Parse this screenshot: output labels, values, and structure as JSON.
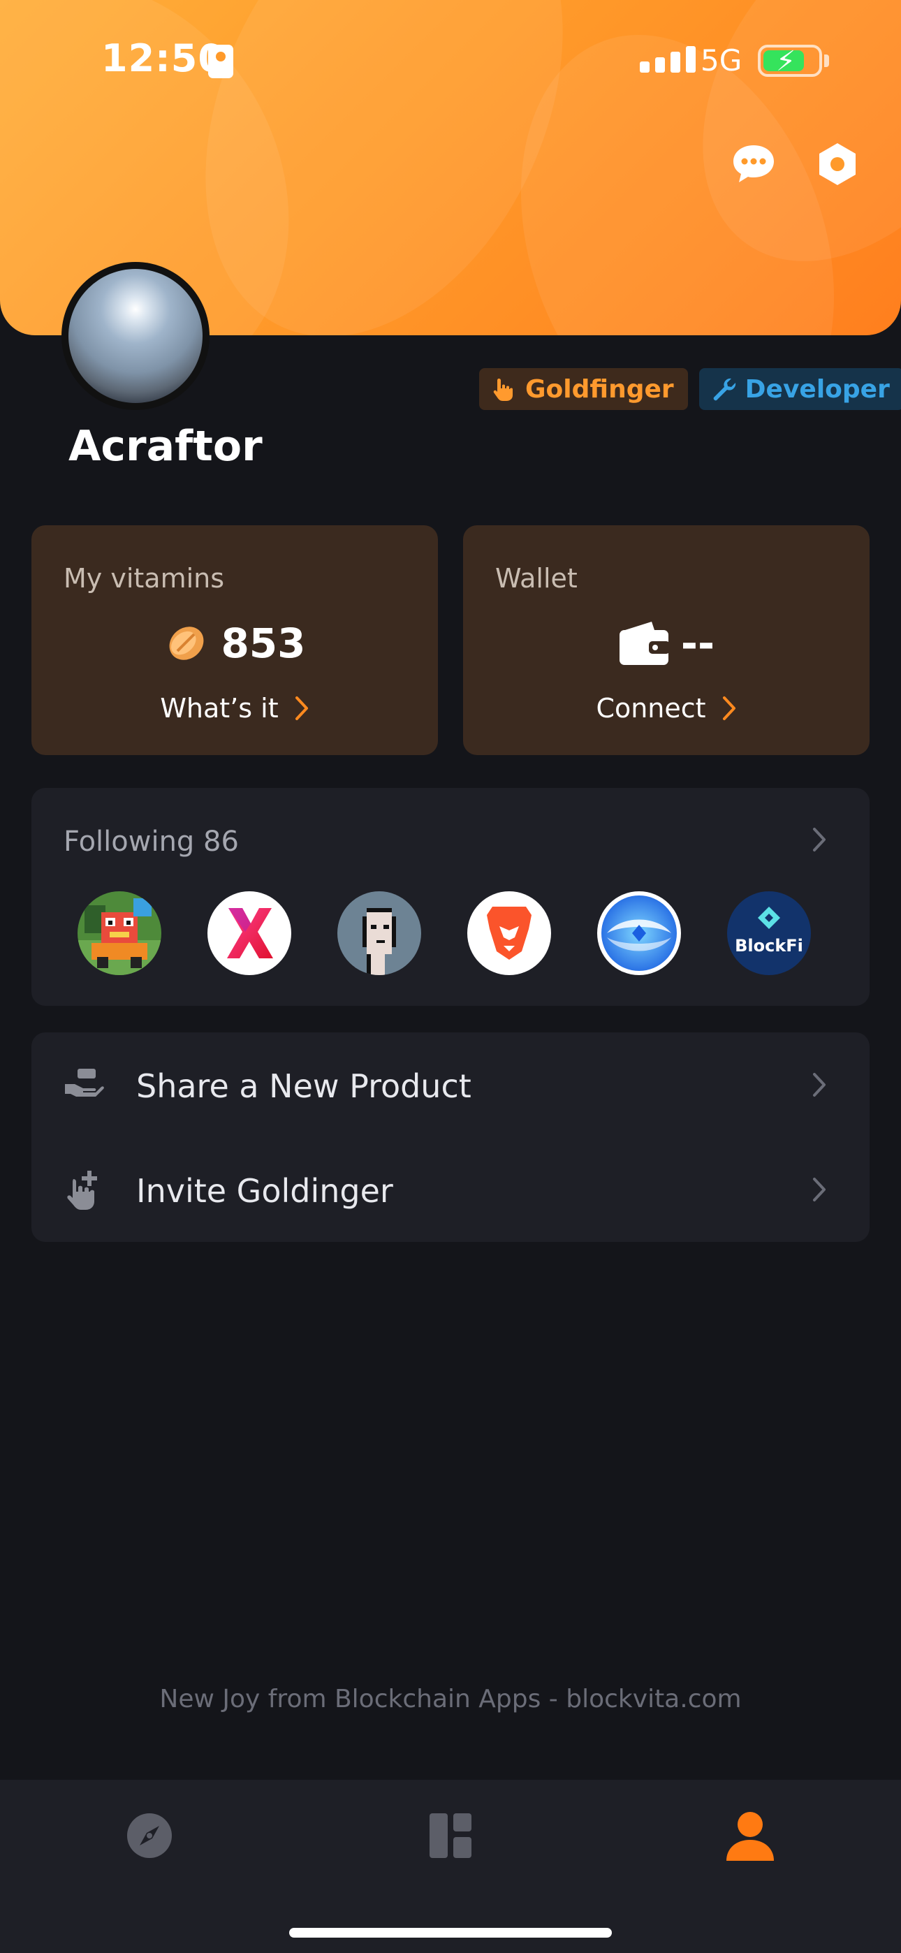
{
  "status_bar": {
    "time": "12:50",
    "network": "5G"
  },
  "header": {
    "message_icon": "chat-bubble-icon",
    "settings_icon": "hexagon-gear-icon"
  },
  "profile": {
    "username": "Acraftor",
    "badges": [
      {
        "label": "Goldfinger",
        "icon": "pointing-hand-icon",
        "color": "#ff9a2e"
      },
      {
        "label": "Developer",
        "icon": "wrench-icon",
        "color": "#38a3e5"
      }
    ]
  },
  "cards": {
    "vitamins": {
      "title": "My vitamins",
      "value": "853",
      "action": "What’s it"
    },
    "wallet": {
      "title": "Wallet",
      "value": "--",
      "action": "Connect"
    }
  },
  "following": {
    "title": "Following 86",
    "apps": [
      {
        "name": "pixel-game-app-icon"
      },
      {
        "name": "x-app-icon"
      },
      {
        "name": "cryptopunk-app-icon"
      },
      {
        "name": "brave-lion-app-icon"
      },
      {
        "name": "blue-swirl-app-icon"
      },
      {
        "name": "blockfi-app-icon",
        "label": "BlockFi"
      }
    ]
  },
  "menu": [
    {
      "label": "Share a New Product",
      "icon": "hand-share-icon"
    },
    {
      "label": "Invite Goldinger",
      "icon": "hand-plus-icon"
    }
  ],
  "footer": {
    "text": "New Joy from Blockchain Apps - blockvita.com"
  },
  "tabs": [
    {
      "name": "discover",
      "icon": "compass-icon",
      "active": false
    },
    {
      "name": "dashboard",
      "icon": "dashboard-icon",
      "active": false
    },
    {
      "name": "profile",
      "icon": "person-icon",
      "active": true
    }
  ],
  "colors": {
    "accent": "#ff8a1f",
    "background": "#14151a",
    "card": "#3b2a1f",
    "panel": "#1e1f26"
  }
}
